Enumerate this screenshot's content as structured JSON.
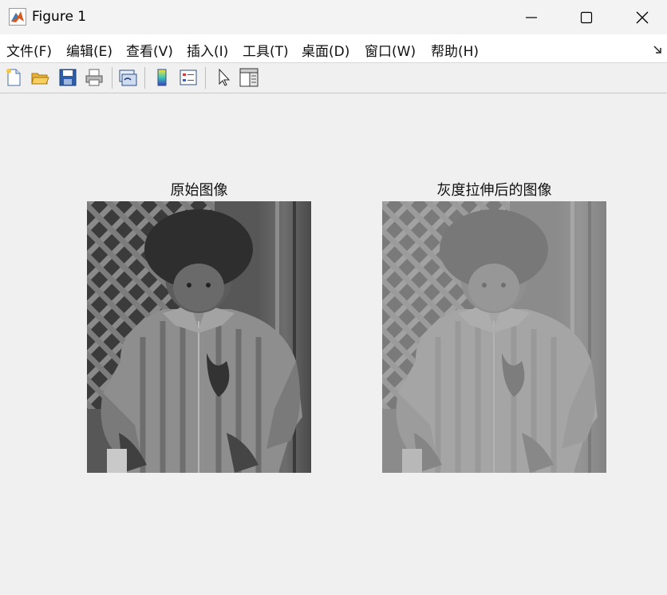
{
  "window": {
    "title": "Figure 1",
    "icons": {
      "app": "matlab-icon",
      "minimize": "minimize-icon",
      "maximize": "maximize-icon",
      "close": "close-icon"
    }
  },
  "menubar": {
    "items": [
      {
        "label": "文件(F)"
      },
      {
        "label": "编辑(E)"
      },
      {
        "label": "查看(V)"
      },
      {
        "label": "插入(I)"
      },
      {
        "label": "工具(T)"
      },
      {
        "label": "桌面(D)"
      },
      {
        "label": "窗口(W)"
      },
      {
        "label": "帮助(H)"
      }
    ],
    "overflow_icon": "dock-arrow-icon"
  },
  "toolbar": {
    "buttons": [
      "new-figure-icon",
      "open-file-icon",
      "save-icon",
      "print-icon",
      "link-plot-icon",
      "insert-colorbar-icon",
      "insert-legend-icon",
      "edit-plot-icon",
      "property-inspector-icon"
    ]
  },
  "figure": {
    "axes": [
      {
        "title": "原始图像",
        "image": "grayscale photo of a child in a jacket"
      },
      {
        "title": "灰度拉伸后的图像",
        "image": "contrast-reduced grayscale photo of the same child"
      }
    ],
    "colors": {
      "original_gray_dark": "#3e3e3e",
      "stretched_gray": "#8c8c8c"
    }
  }
}
